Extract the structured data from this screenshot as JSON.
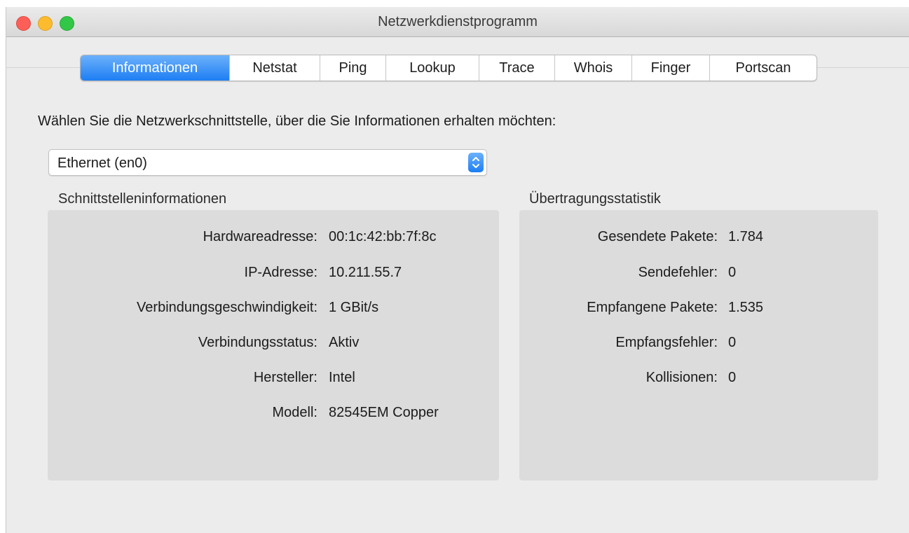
{
  "window": {
    "title": "Netzwerkdienstprogramm"
  },
  "tabs": [
    {
      "label": "Informationen",
      "active": true
    },
    {
      "label": "Netstat",
      "active": false
    },
    {
      "label": "Ping",
      "active": false
    },
    {
      "label": "Lookup",
      "active": false
    },
    {
      "label": "Trace",
      "active": false
    },
    {
      "label": "Whois",
      "active": false
    },
    {
      "label": "Finger",
      "active": false
    },
    {
      "label": "Portscan",
      "active": false
    }
  ],
  "prompt": "Wählen Sie die Netzwerkschnittstelle, über die Sie Informationen erhalten möchten:",
  "interface_select": {
    "value": "Ethernet (en0)"
  },
  "interface_info": {
    "title": "Schnittstelleninformationen",
    "rows": [
      {
        "label": "Hardwareadresse:",
        "value": "00:1c:42:bb:7f:8c"
      },
      {
        "label": "IP-Adresse:",
        "value": "10.211.55.7"
      },
      {
        "label": "Verbindungsgeschwindigkeit:",
        "value": "1 GBit/s"
      },
      {
        "label": "Verbindungsstatus:",
        "value": "Aktiv"
      },
      {
        "label": "Hersteller:",
        "value": "Intel"
      },
      {
        "label": "Modell:",
        "value": "82545EM Copper"
      }
    ]
  },
  "transfer_stats": {
    "title": "Übertragungsstatistik",
    "rows": [
      {
        "label": "Gesendete Pakete:",
        "value": "1.784"
      },
      {
        "label": "Sendefehler:",
        "value": "0"
      },
      {
        "label": "Empfangene Pakete:",
        "value": "1.535"
      },
      {
        "label": "Empfangsfehler:",
        "value": "0"
      },
      {
        "label": "Kollisionen:",
        "value": "0"
      }
    ]
  },
  "colors": {
    "accent": "#1d7ef3",
    "close": "#fc5f57",
    "minimize": "#fdbc2e",
    "maximize": "#33c748"
  }
}
